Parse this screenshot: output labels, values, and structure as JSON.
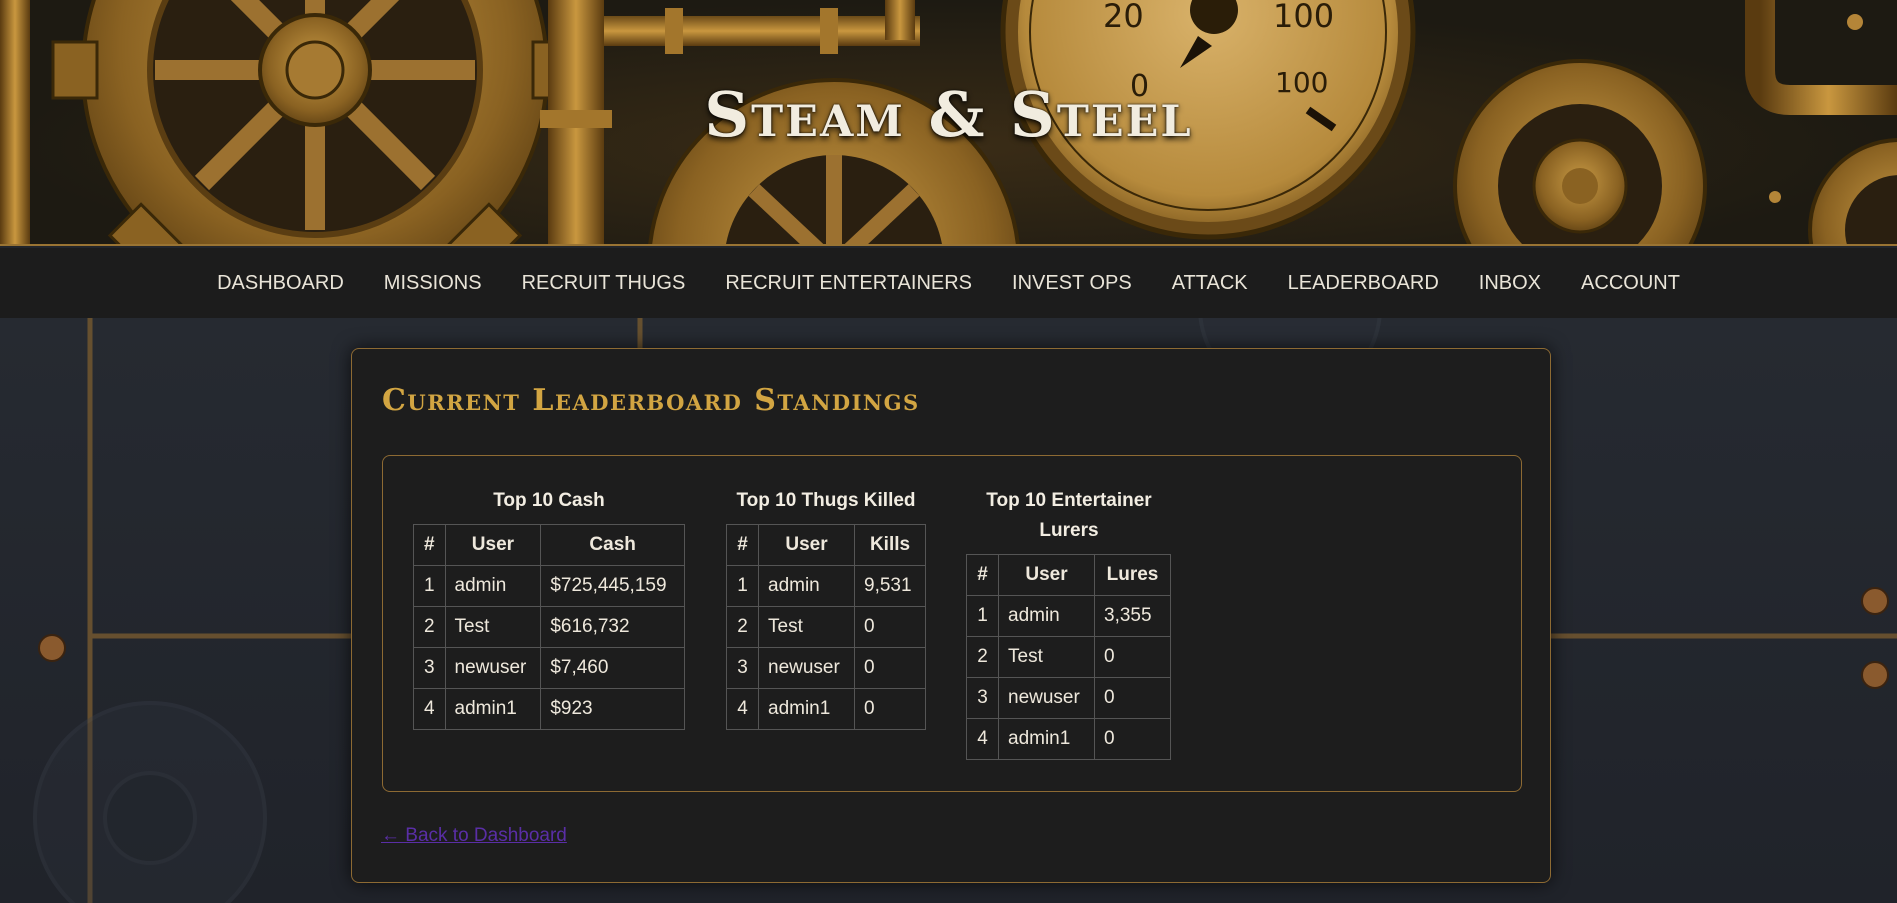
{
  "site": {
    "title": "Steam & Steel"
  },
  "nav": {
    "items": [
      "DASHBOARD",
      "MISSIONS",
      "RECRUIT THUGS",
      "RECRUIT ENTERTAINERS",
      "INVEST OPS",
      "ATTACK",
      "LEADERBOARD",
      "INBOX",
      "ACCOUNT"
    ]
  },
  "leaderboard": {
    "title": "Current Leaderboard Standings",
    "cash": {
      "title": "Top 10 Cash",
      "headers": [
        "#",
        "User",
        "Cash"
      ],
      "rows": [
        [
          "1",
          "admin",
          "$725,445,159"
        ],
        [
          "2",
          "Test",
          "$616,732"
        ],
        [
          "3",
          "newuser",
          "$7,460"
        ],
        [
          "4",
          "admin1",
          "$923"
        ]
      ]
    },
    "kills": {
      "title": "Top 10 Thugs Killed",
      "headers": [
        "#",
        "User",
        "Kills"
      ],
      "rows": [
        [
          "1",
          "admin",
          "9,531"
        ],
        [
          "2",
          "Test",
          "0"
        ],
        [
          "3",
          "newuser",
          "0"
        ],
        [
          "4",
          "admin1",
          "0"
        ]
      ]
    },
    "lures": {
      "title_line1": "Top 10 Entertainer",
      "title_line2": "Lurers",
      "headers": [
        "#",
        "User",
        "Lures"
      ],
      "rows": [
        [
          "1",
          "admin",
          "3,355"
        ],
        [
          "2",
          "Test",
          "0"
        ],
        [
          "3",
          "newuser",
          "0"
        ],
        [
          "4",
          "admin1",
          "0"
        ]
      ]
    },
    "back_link": "← Back to Dashboard"
  },
  "gauge": {
    "labels": [
      "20",
      "100",
      "0",
      "100"
    ]
  },
  "colors": {
    "accent_gold": "#d2a542",
    "border_bronze": "#8d6a33",
    "nav_bg": "#1c1c1c",
    "card_bg": "#1d1d1d",
    "link": "#5a2ea6"
  }
}
